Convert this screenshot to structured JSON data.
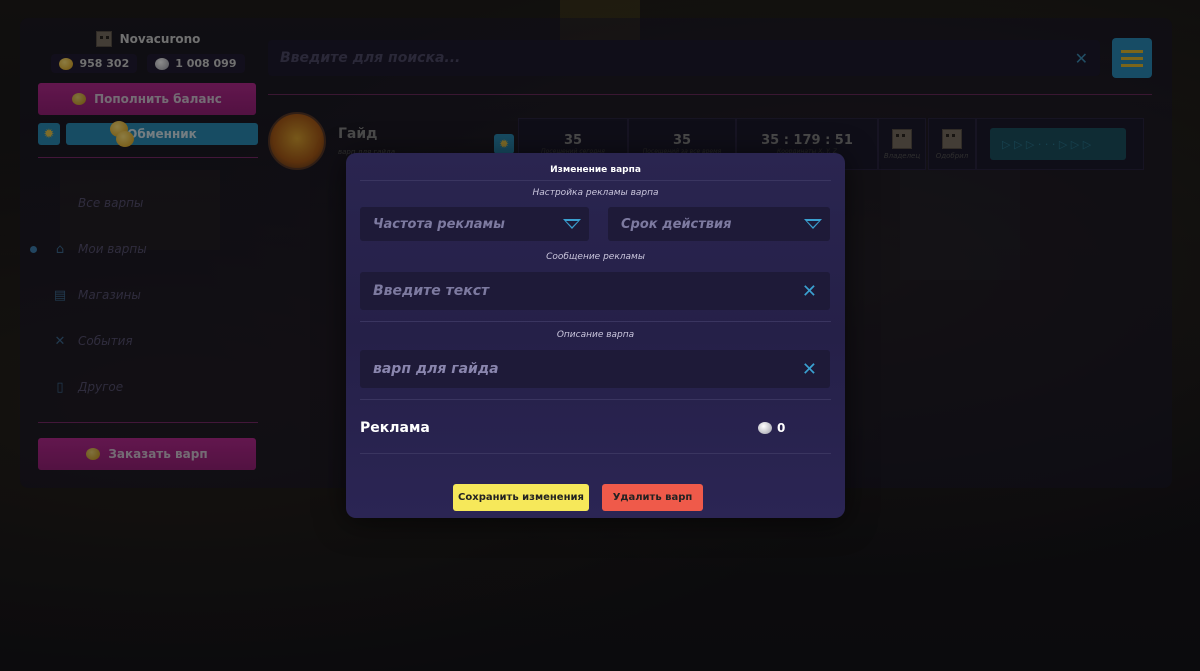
{
  "user": {
    "name": "Novacurono",
    "gold": "958 302",
    "silver": "1 008 099"
  },
  "sidebar": {
    "topup_label": "Пополнить баланс",
    "exchange_label": "Обменник",
    "nav": [
      {
        "label": "Все варпы",
        "icon": "none",
        "active": false
      },
      {
        "label": "Мои варпы",
        "icon": "home-icon",
        "active": true
      },
      {
        "label": "Магазины",
        "icon": "shop-icon",
        "active": false
      },
      {
        "label": "События",
        "icon": "swords-icon",
        "active": false
      },
      {
        "label": "Другое",
        "icon": "map-icon",
        "active": false
      }
    ],
    "order_label": "Заказать варп"
  },
  "search": {
    "placeholder": "Введите для поиска..."
  },
  "warp": {
    "name": "Гайд",
    "description": "варп для гайда",
    "visits_today": "35",
    "visits_today_label": "Посещений сегодня",
    "visits_total": "35",
    "visits_total_label": "Посещений за все время",
    "coords": "35 : 179 : 51",
    "coords_label": "Координаты X, Y, Z",
    "owner_label": "Владелец",
    "approved_label": "Одобрил",
    "progress_glyphs": "▷ ▷ ▷ · · · ▷ ▷ ▷"
  },
  "modal": {
    "title": "Изменение варпа",
    "ad_settings_label": "Настройка рекламы варпа",
    "ad_frequency": "Частота рекламы",
    "ad_duration": "Срок действия",
    "ad_message_label": "Сообщение рекламы",
    "ad_message_placeholder": "Введите текст",
    "description_label": "Описание варпа",
    "description_value": "варп для гайда",
    "ad_label": "Реклама",
    "ad_cost": "0",
    "save_label": "Сохранить изменения",
    "delete_label": "Удалить варп"
  },
  "colors": {
    "accent_pink": "#b8278e",
    "accent_blue": "#2b8bb5",
    "save_yellow": "#f6e85a",
    "delete_red": "#ef5a4a",
    "modal_bg": "#27224e"
  }
}
